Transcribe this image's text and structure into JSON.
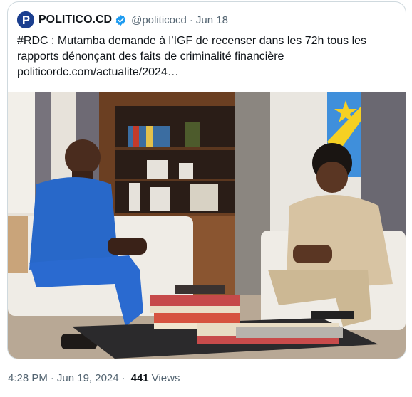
{
  "tweet": {
    "author_name": "POLITICO.CD",
    "handle": "@politicocd",
    "separator": "·",
    "date": "Jun 18",
    "text_line1": "#RDC : Mutamba demande à l’IGF de recenser dans les 72h tous les",
    "text_line2": "rapports dénonçant des faits de criminalité financière",
    "link": "politicordc.com/actualite/2024…",
    "avatar_icon": "politico-logo-icon",
    "verified_icon": "verified-badge-icon",
    "colors": {
      "verified": "#1d9bf0",
      "avatar_bg": "#1b3f8f",
      "border": "#cfd9de",
      "muted": "#536471"
    }
  },
  "footer": {
    "time": "4:28 PM",
    "separator": "·",
    "date": "Jun 19, 2024",
    "separator2": "·",
    "views_count": "441",
    "views_label": "Views"
  }
}
